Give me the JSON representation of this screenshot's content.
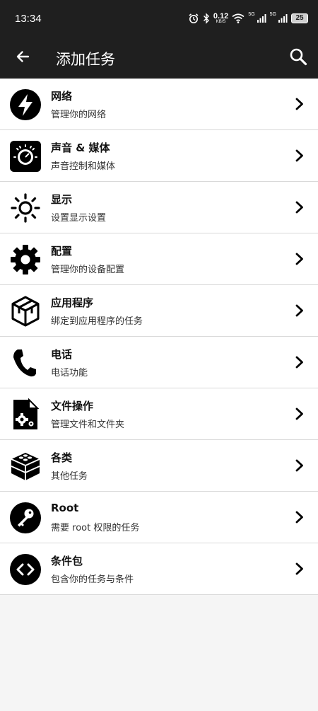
{
  "status_bar": {
    "time": "13:34",
    "net_speed_value": "0.12",
    "net_speed_unit": "KB/S",
    "signal1_label": "5G",
    "signal2_label": "5G",
    "battery": "25"
  },
  "app_bar": {
    "title": "添加任务"
  },
  "categories": [
    {
      "title": "网络",
      "subtitle": "管理你的网络",
      "icon": "lightning-icon"
    },
    {
      "title": "声音 & 媒体",
      "subtitle": "声音控制和媒体",
      "icon": "speaker-knob-icon"
    },
    {
      "title": "显示",
      "subtitle": "设置显示设置",
      "icon": "sun-brightness-icon"
    },
    {
      "title": "配置",
      "subtitle": "管理你的设备配置",
      "icon": "gear-icon"
    },
    {
      "title": "应用程序",
      "subtitle": "绑定到应用程序的任务",
      "icon": "cube-icon"
    },
    {
      "title": "电话",
      "subtitle": "电话功能",
      "icon": "phone-icon"
    },
    {
      "title": "文件操作",
      "subtitle": "管理文件和文件夹",
      "icon": "file-gear-icon"
    },
    {
      "title": "各类",
      "subtitle": "其他任务",
      "icon": "bricks-icon"
    },
    {
      "title": "Root",
      "subtitle": "需要 root 权限的任务",
      "icon": "key-icon"
    },
    {
      "title": "条件包",
      "subtitle": "包含你的任务与条件",
      "icon": "code-brackets-icon"
    }
  ],
  "colors": {
    "bar_background": "#1f1f1f",
    "list_background": "#ffffff",
    "page_background": "#f5f5f5",
    "divider": "#d9d9d9"
  }
}
